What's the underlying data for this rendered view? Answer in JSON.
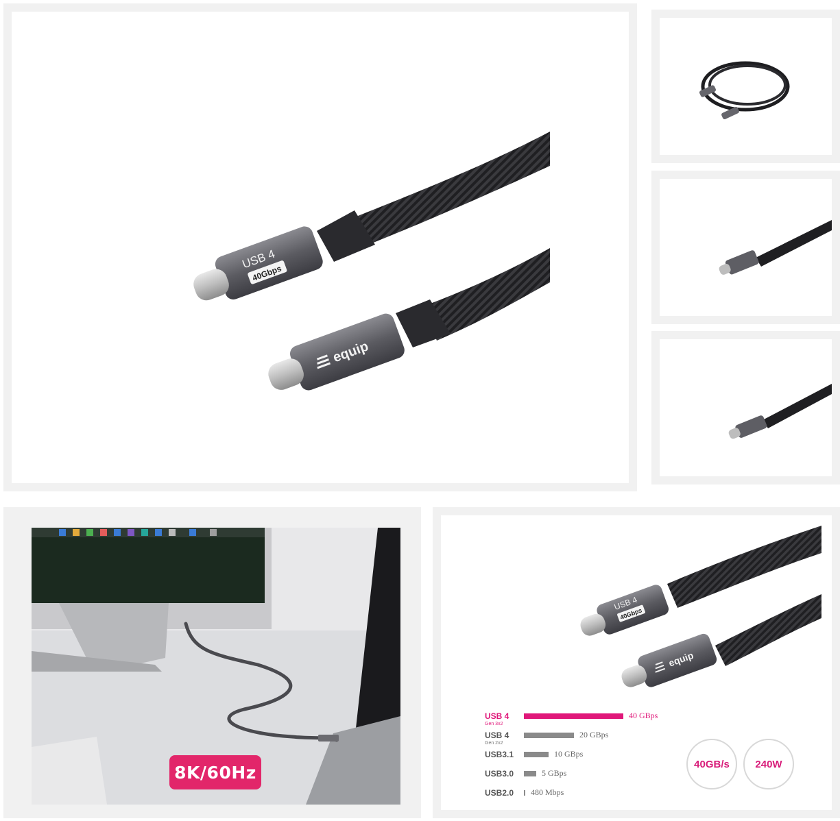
{
  "main_image": {
    "connector_top_line1": "USB 4",
    "connector_top_line2": "40Gbps",
    "connector_bottom_brand": "equip"
  },
  "thumbnails": [
    {
      "name": "cable-coiled"
    },
    {
      "name": "connector-usb4"
    },
    {
      "name": "connector-equip"
    }
  ],
  "lifestyle": {
    "badge": "8K/60Hz"
  },
  "speed_panel": {
    "connector_top_line1": "USB 4",
    "connector_top_line2": "40Gbps",
    "connector_bottom_brand": "equip",
    "rows": [
      {
        "label": "USB 4",
        "sub": "Gen 3x2",
        "value": "40 GBps",
        "fraction": 1.0
      },
      {
        "label": "USB 4",
        "sub": "Gen 2x2",
        "value": "20 GBps",
        "fraction": 0.5
      },
      {
        "label": "USB3.1",
        "sub": "",
        "value": "10 GBps",
        "fraction": 0.25
      },
      {
        "label": "USB3.0",
        "sub": "",
        "value": "5 GBps",
        "fraction": 0.125
      },
      {
        "label": "USB2.0",
        "sub": "",
        "value": "480 Mbps",
        "fraction": 0.012
      }
    ],
    "badge_speed": "40GB/s",
    "badge_power": "240W",
    "accent_color": "#e0187a"
  }
}
